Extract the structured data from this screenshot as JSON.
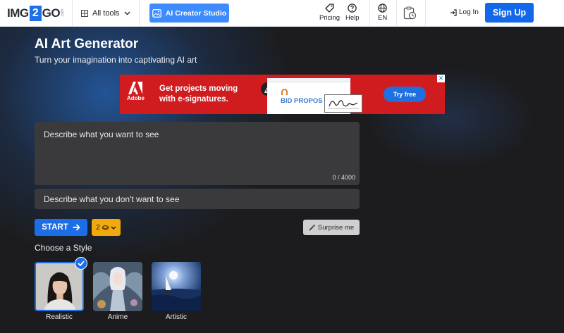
{
  "header": {
    "logo": {
      "left": "IMG",
      "middle": "2",
      "right": "GO",
      "suffix": ".com"
    },
    "all_tools_label": "All tools",
    "creator_studio_label": "AI Creator Studio",
    "pricing_label": "Pricing",
    "help_label": "Help",
    "language_label": "EN",
    "login_label": "Log In",
    "signup_label": "Sign Up"
  },
  "hero": {
    "title": "AI Art Generator",
    "subtitle": "Turn your imagination into captivating AI art"
  },
  "ad": {
    "brand": "Adobe",
    "headline_line1": "Get projects moving",
    "headline_line2": "with e-signatures.",
    "document_text": "BID PROPOS",
    "cta_label": "Try free",
    "close_label": "✕"
  },
  "prompt": {
    "placeholder": "Describe what you want to see",
    "counter": "0 / 4000"
  },
  "negative_prompt": {
    "placeholder": "Describe what you don't want to see"
  },
  "actions": {
    "start_label": "START",
    "credits_value": "2",
    "surprise_label": "Surprise me"
  },
  "styles": {
    "heading": "Choose a Style",
    "items": [
      {
        "label": "Realistic",
        "selected": true
      },
      {
        "label": "Anime",
        "selected": false
      },
      {
        "label": "Artistic",
        "selected": false
      }
    ]
  },
  "colors": {
    "primary": "#1c6de6",
    "creator_button": "#3d8bfd",
    "credits": "#f1a90c",
    "ad_red": "#d01c1f",
    "panel": "#3a3a3c",
    "background": "#1c1c1e"
  },
  "icons": {
    "grid": "grid-icon",
    "chevron": "chevron-down-icon",
    "creator": "image-sparkle-icon",
    "pricing": "tag-icon",
    "help": "question-icon",
    "language": "globe-icon",
    "history": "clipboard-clock-icon",
    "login": "login-arrow-icon",
    "start": "arrow-right-icon",
    "credits": "coin-icon",
    "surprise": "magic-wand-icon",
    "check": "checkmark-icon"
  }
}
